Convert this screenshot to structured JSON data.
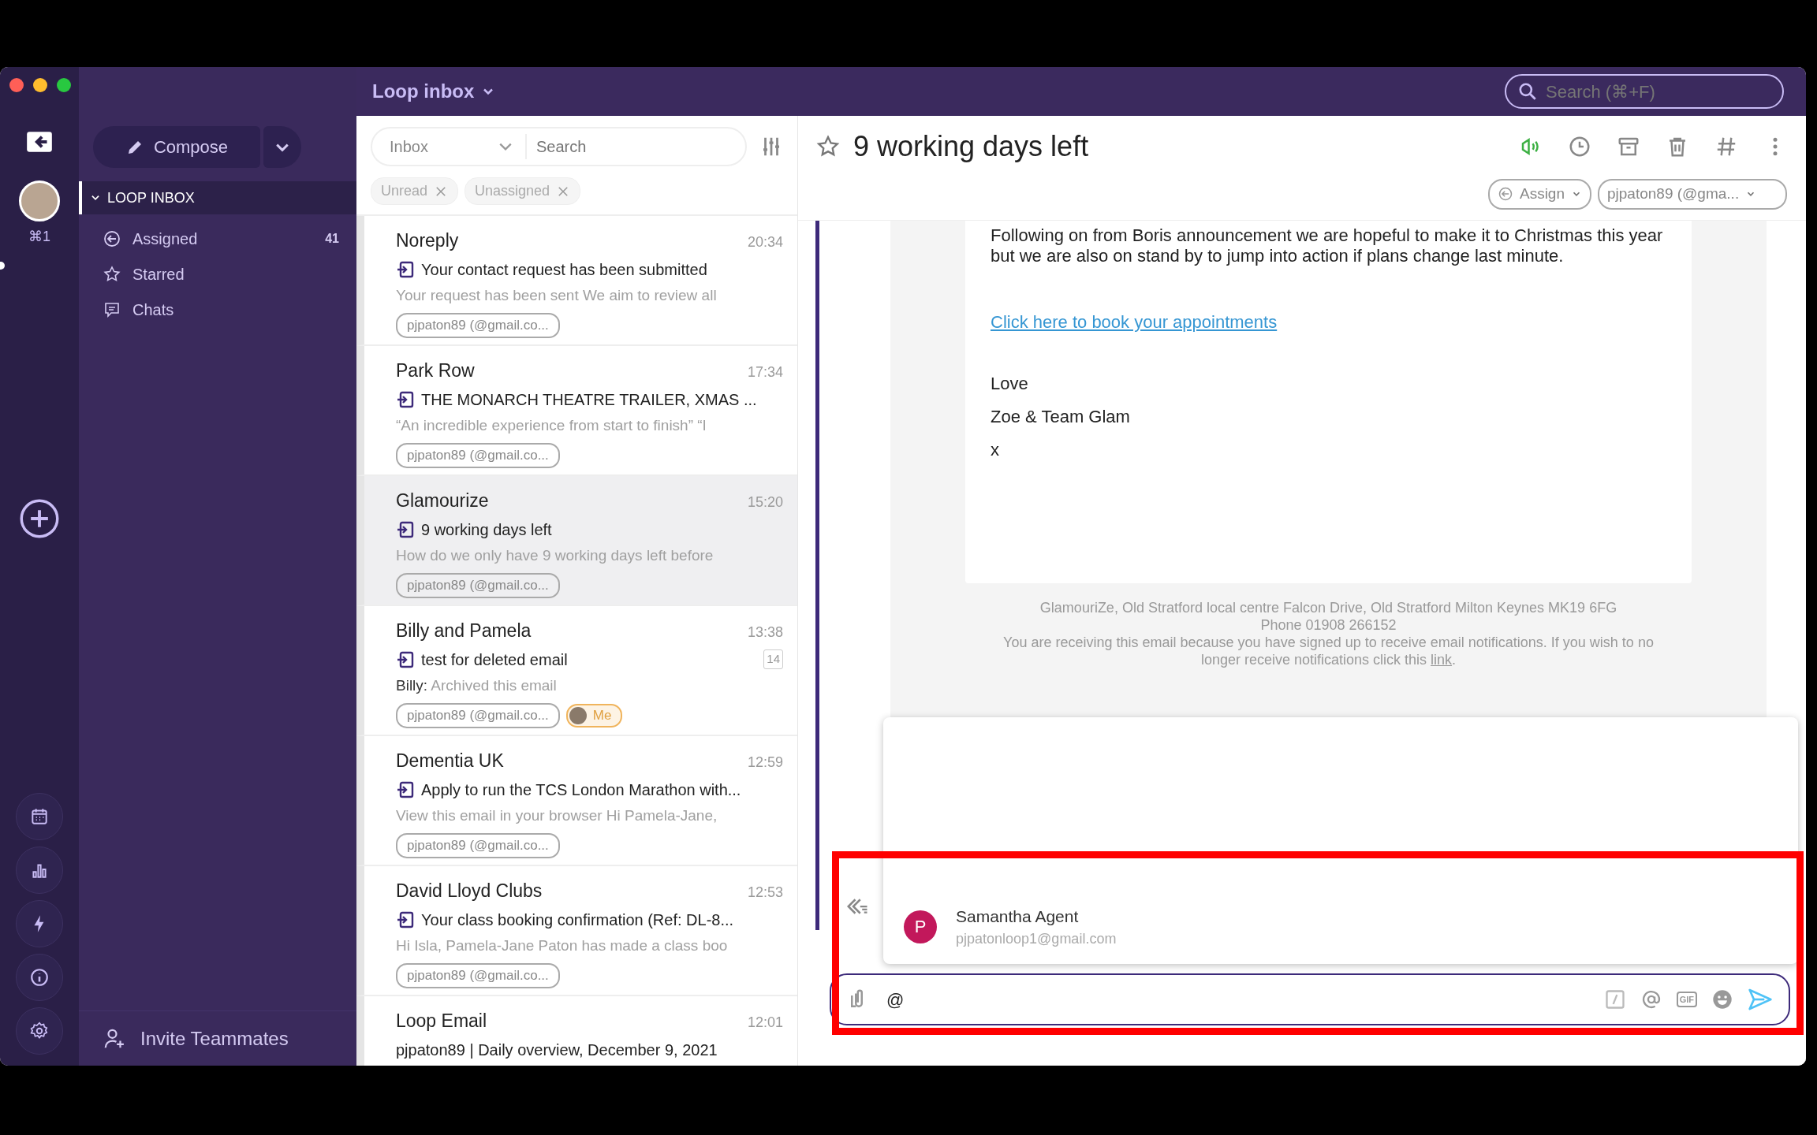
{
  "rail": {
    "account_shortcut": "⌘1"
  },
  "compose": {
    "label": "Compose"
  },
  "sidebar": {
    "section": "LOOP INBOX",
    "expanded": true,
    "items": [
      {
        "kind": "assigned",
        "label": "Assigned",
        "count": "41"
      },
      {
        "kind": "starred",
        "label": "Starred"
      },
      {
        "kind": "chats",
        "label": "Chats"
      }
    ],
    "invite": "Invite Teammates"
  },
  "topbar": {
    "inbox_title": "Loop inbox",
    "search_placeholder": "Search (⌘+F)"
  },
  "list": {
    "folder": "Inbox",
    "search_placeholder": "Search",
    "filters": [
      "Unread",
      "Unassigned"
    ],
    "conversations": [
      {
        "kind": "email",
        "sender": "Noreply",
        "time": "20:34",
        "subject": "Your contact request has been submitted",
        "preview": "Your request has been sent We aim to review all",
        "account": "pjpaton89 (@gmail.co...",
        "selected": false
      },
      {
        "kind": "email",
        "sender": "Park Row",
        "time": "17:34",
        "subject": "THE MONARCH THEATRE TRAILER, XMAS ...",
        "preview": "“An incredible experience from start to finish” “I",
        "account": "pjpaton89 (@gmail.co...",
        "selected": false
      },
      {
        "kind": "email",
        "sender": "Glamourize",
        "time": "15:20",
        "subject": "9 working days left",
        "preview": "How do we only have 9 working days left before",
        "account": "pjpaton89 (@gmail.co...",
        "selected": true
      },
      {
        "kind": "email",
        "sender": "Billy and Pamela",
        "time": "13:38",
        "subject": "test for deleted email",
        "count": "14",
        "preview_author": "Billy:",
        "preview": "Archived this email",
        "account": "pjpaton89 (@gmail.co...",
        "assignee": "Me",
        "selected": false
      },
      {
        "kind": "email",
        "sender": "Dementia UK",
        "time": "12:59",
        "subject": "Apply to run the TCS London Marathon with...",
        "preview": "View this email in your browser Hi Pamela-Jane,",
        "account": "pjpaton89 (@gmail.co...",
        "selected": false
      },
      {
        "kind": "email",
        "sender": "David Lloyd Clubs",
        "time": "12:53",
        "subject": "Your class booking confirmation (Ref: DL-8...",
        "preview": "Hi Isla, Pamela-Jane Paton has made a class boo",
        "account": "pjpaton89 (@gmail.co...",
        "selected": false
      },
      {
        "kind": "summary",
        "sender": "Loop Email",
        "time": "12:01",
        "subject": "pjpaton89 | Daily overview, December 9, 2021",
        "selected": false
      }
    ]
  },
  "detail": {
    "title": "9 working days left",
    "starred": false,
    "assign_label": "Assign",
    "account": "pjpaton89 (@gma...",
    "body": {
      "paragraph": "Following on from Boris announcement we are hopeful to make it to Christmas this year but we are also on stand by to jump into action if plans change last minute.",
      "link": "Click here to book your appointments ",
      "signoff": [
        "Love",
        "Zoe & Team Glam",
        "x"
      ]
    },
    "footer": {
      "address": "GlamouriZe, Old Stratford local centre Falcon Drive, Old Stratford Milton Keynes MK19 6FG",
      "phone": "Phone 01908 266152",
      "notice": "You are receiving this email because you have signed up to receive email notifications. If you wish to no longer receive notifications click this ",
      "notice_link": "link",
      "notice_end": "."
    }
  },
  "mentions": [
    {
      "initial": "P",
      "name": "Samantha Agent",
      "email": "pjpatonloop1@gmail.com"
    }
  ],
  "composer": {
    "value": "@",
    "gif_label": "GIF"
  }
}
